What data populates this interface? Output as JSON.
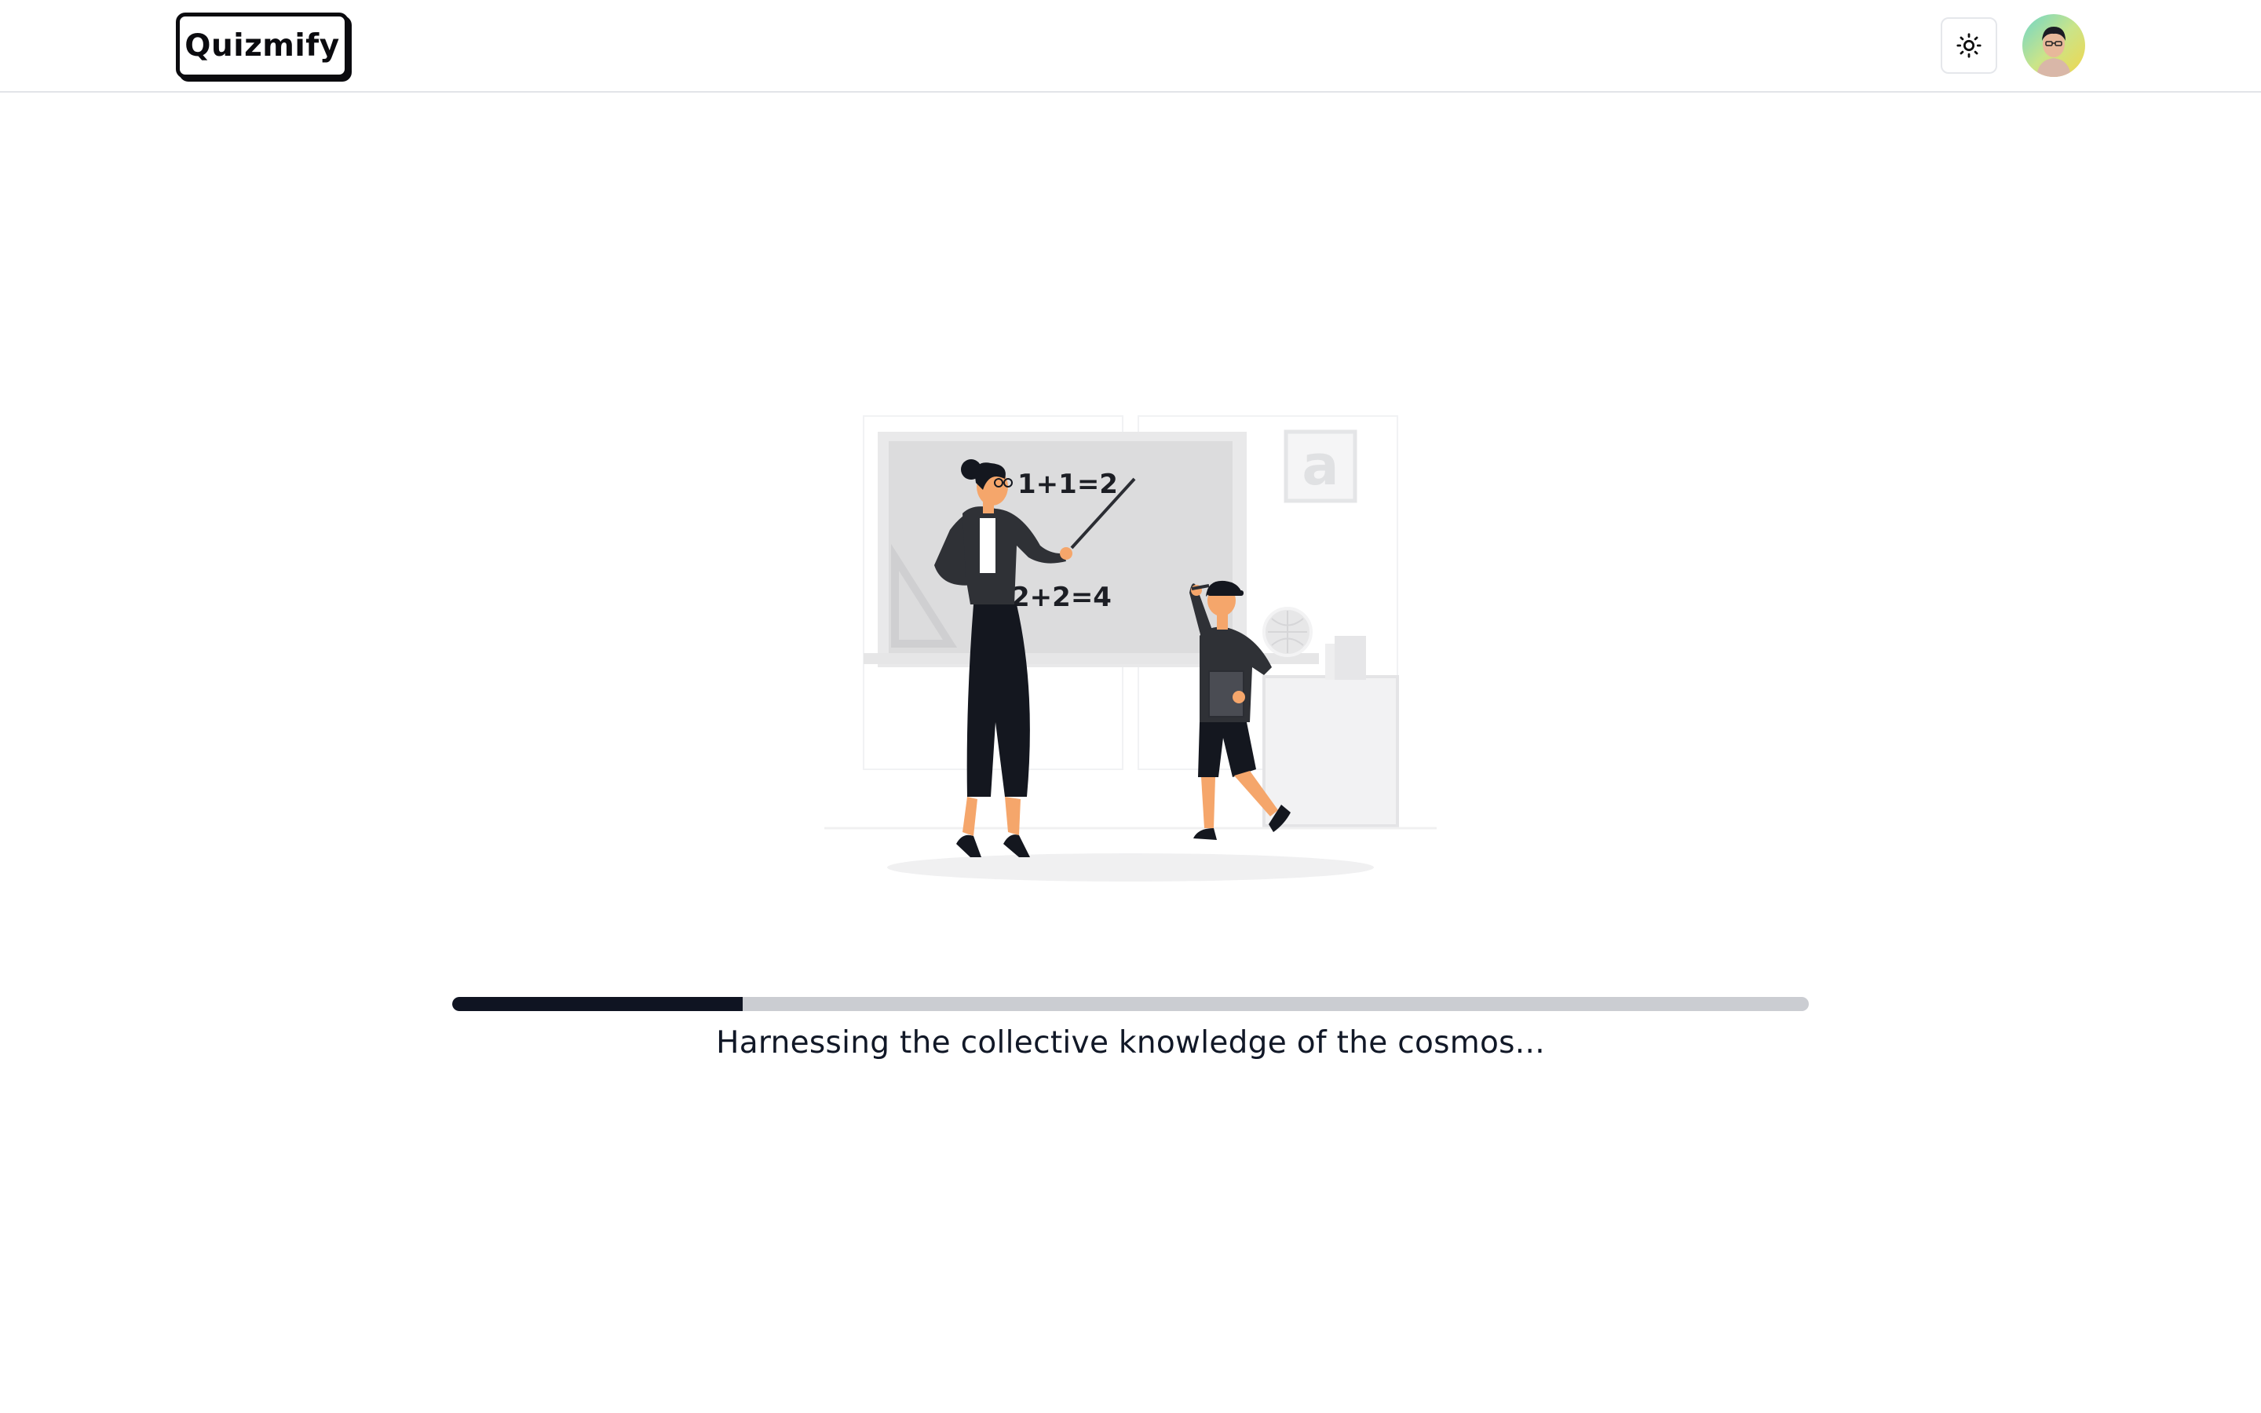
{
  "header": {
    "logo_text": "Quizmify",
    "theme_toggle_icon": "sun-icon",
    "avatar_icon": "user-avatar"
  },
  "illustration": {
    "board_line_1": "1+1=2",
    "board_line_2": "2+2=4",
    "poster_letter": "a"
  },
  "loading": {
    "progress": 0.214,
    "message": "Harnessing the collective knowledge of the cosmos..."
  },
  "colors": {
    "accent_dark": "#0f1422",
    "track": "#cbcdd2",
    "skin": "#f5a66b"
  }
}
